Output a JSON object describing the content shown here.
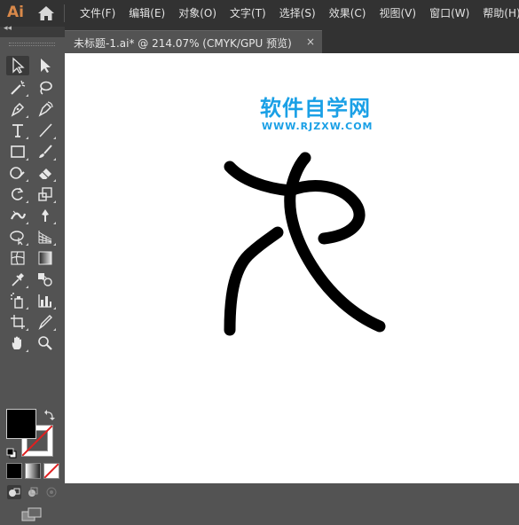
{
  "app": {
    "logo_text": "Ai"
  },
  "menus": [
    {
      "label": "文件(F)"
    },
    {
      "label": "编辑(E)"
    },
    {
      "label": "对象(O)"
    },
    {
      "label": "文字(T)"
    },
    {
      "label": "选择(S)"
    },
    {
      "label": "效果(C)"
    },
    {
      "label": "视图(V)"
    },
    {
      "label": "窗口(W)"
    },
    {
      "label": "帮助(H)"
    }
  ],
  "toolbar": {
    "collapse_glyph": "◂◂"
  },
  "document": {
    "tab_title": "未标题-1.ai* @ 214.07% (CMYK/GPU 预览)",
    "close_glyph": "×"
  },
  "watermark": {
    "title": "软件自学网",
    "url": "WWW.RJZXW.COM"
  },
  "colors": {
    "menubar_bg": "#323232",
    "panel_bg": "#535353",
    "canvas_bg": "#ffffff",
    "fill": "#000000",
    "stroke_none_slash": "#e02020",
    "watermark": "#1aa0e6",
    "logo": "#d9894a"
  }
}
